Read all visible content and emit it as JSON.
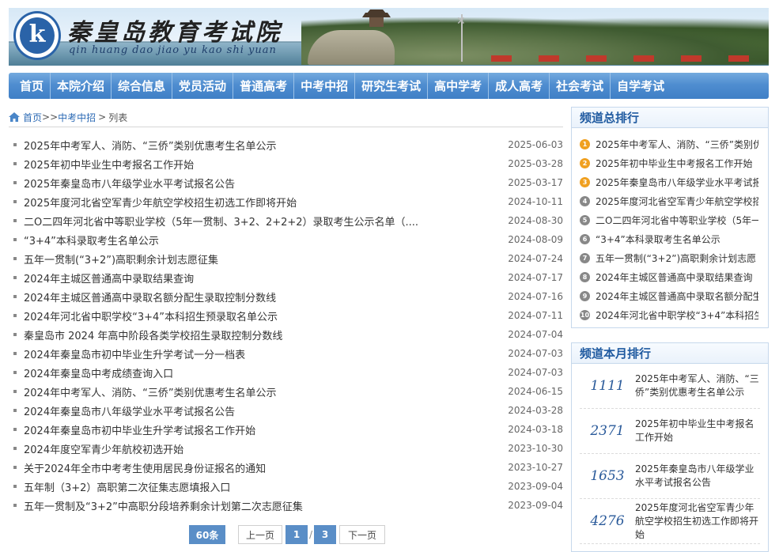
{
  "header": {
    "title": "秦皇岛教育考试院",
    "pinyin": "qin huang dao jiao yu kao shi yuan",
    "logo_letter": "k"
  },
  "nav": [
    {
      "label": "首页"
    },
    {
      "label": "本院介绍"
    },
    {
      "label": "综合信息"
    },
    {
      "label": "党员活动"
    },
    {
      "label": "普通高考"
    },
    {
      "label": "中考中招"
    },
    {
      "label": "研究生考试"
    },
    {
      "label": "高中学考"
    },
    {
      "label": "成人高考"
    },
    {
      "label": "社会考试"
    },
    {
      "label": "自学考试"
    }
  ],
  "breadcrumb": {
    "home": "首页",
    "sep1": ">>",
    "section": "中考中招",
    "sep2": ">",
    "current": "列表"
  },
  "articles": [
    {
      "title": "2025年中考军人、消防、“三侨”类别优惠考生名单公示",
      "date": "2025-06-03"
    },
    {
      "title": "2025年初中毕业生中考报名工作开始",
      "date": "2025-03-28"
    },
    {
      "title": "2025年秦皇岛市八年级学业水平考试报名公告",
      "date": "2025-03-17"
    },
    {
      "title": "2025年度河北省空军青少年航空学校招生初选工作即将开始",
      "date": "2024-10-11"
    },
    {
      "title": "二O二四年河北省中等职业学校（5年一贯制、3+2、2+2+2）录取考生公示名单（....",
      "date": "2024-08-30"
    },
    {
      "title": "“3+4”本科录取考生名单公示",
      "date": "2024-08-09"
    },
    {
      "title": "五年一贯制(“3+2”)高职剩余计划志愿征集",
      "date": "2024-07-24"
    },
    {
      "title": "2024年主城区普通高中录取结果查询",
      "date": "2024-07-17"
    },
    {
      "title": "2024年主城区普通高中录取名额分配生录取控制分数线",
      "date": "2024-07-16"
    },
    {
      "title": "2024年河北省中职学校“3+4”本科招生预录取名单公示",
      "date": "2024-07-11"
    },
    {
      "title": "秦皇岛市 2024 年高中阶段各类学校招生录取控制分数线",
      "date": "2024-07-04"
    },
    {
      "title": "2024年秦皇岛市初中毕业生升学考试一分一档表",
      "date": "2024-07-03"
    },
    {
      "title": "2024年秦皇岛中考成绩查询入口",
      "date": "2024-07-03"
    },
    {
      "title": "2024年中考军人、消防、“三侨”类别优惠考生名单公示",
      "date": "2024-06-15"
    },
    {
      "title": "2024年秦皇岛市八年级学业水平考试报名公告",
      "date": "2024-03-28"
    },
    {
      "title": "2024年秦皇岛市初中毕业生升学考试报名工作开始",
      "date": "2024-03-18"
    },
    {
      "title": "2024年度空军青少年航校初选开始",
      "date": "2023-10-30"
    },
    {
      "title": "关于2024年全市中考考生使用居民身份证报名的通知",
      "date": "2023-10-27"
    },
    {
      "title": "五年制（3+2）高职第二次征集志愿填报入口",
      "date": "2023-09-04"
    },
    {
      "title": "五年一贯制及“3+2”中高职分段培养剩余计划第二次志愿征集",
      "date": "2023-09-04"
    }
  ],
  "pager": {
    "count": "60条",
    "prev": "上一页",
    "current": "1",
    "sep": "/",
    "total": "3",
    "next": "下一页"
  },
  "rank_box": {
    "title": "频道总排行",
    "items": [
      {
        "num": "1",
        "color": "#f0a020",
        "title": "2025年中考军人、消防、“三侨”类别优"
      },
      {
        "num": "2",
        "color": "#f0a020",
        "title": "2025年初中毕业生中考报名工作开始"
      },
      {
        "num": "3",
        "color": "#f0a020",
        "title": "2025年秦皇岛市八年级学业水平考试报"
      },
      {
        "num": "4",
        "color": "#888888",
        "title": "2025年度河北省空军青少年航空学校招"
      },
      {
        "num": "5",
        "color": "#888888",
        "title": "二O二四年河北省中等职业学校（5年一"
      },
      {
        "num": "6",
        "color": "#888888",
        "title": "“3+4”本科录取考生名单公示"
      },
      {
        "num": "7",
        "color": "#888888",
        "title": "五年一贯制(“3+2”)高职剩余计划志愿"
      },
      {
        "num": "8",
        "color": "#888888",
        "title": "2024年主城区普通高中录取结果查询"
      },
      {
        "num": "9",
        "color": "#888888",
        "title": "2024年主城区普通高中录取名额分配生"
      },
      {
        "num": "10",
        "color": "#888888",
        "title": "2024年河北省中职学校“3+4”本科招生"
      }
    ]
  },
  "month_box": {
    "title": "频道本月排行",
    "items": [
      {
        "hits": "1111",
        "title": "2025年中考军人、消防、“三侨”类别优惠考生名单公示"
      },
      {
        "hits": "2371",
        "title": "2025年初中毕业生中考报名工作开始"
      },
      {
        "hits": "1653",
        "title": "2025年秦皇岛市八年级学业水平考试报名公告"
      },
      {
        "hits": "4276",
        "title": "2025年度河北省空军青少年航空学校招生初选工作即将开始"
      }
    ]
  }
}
